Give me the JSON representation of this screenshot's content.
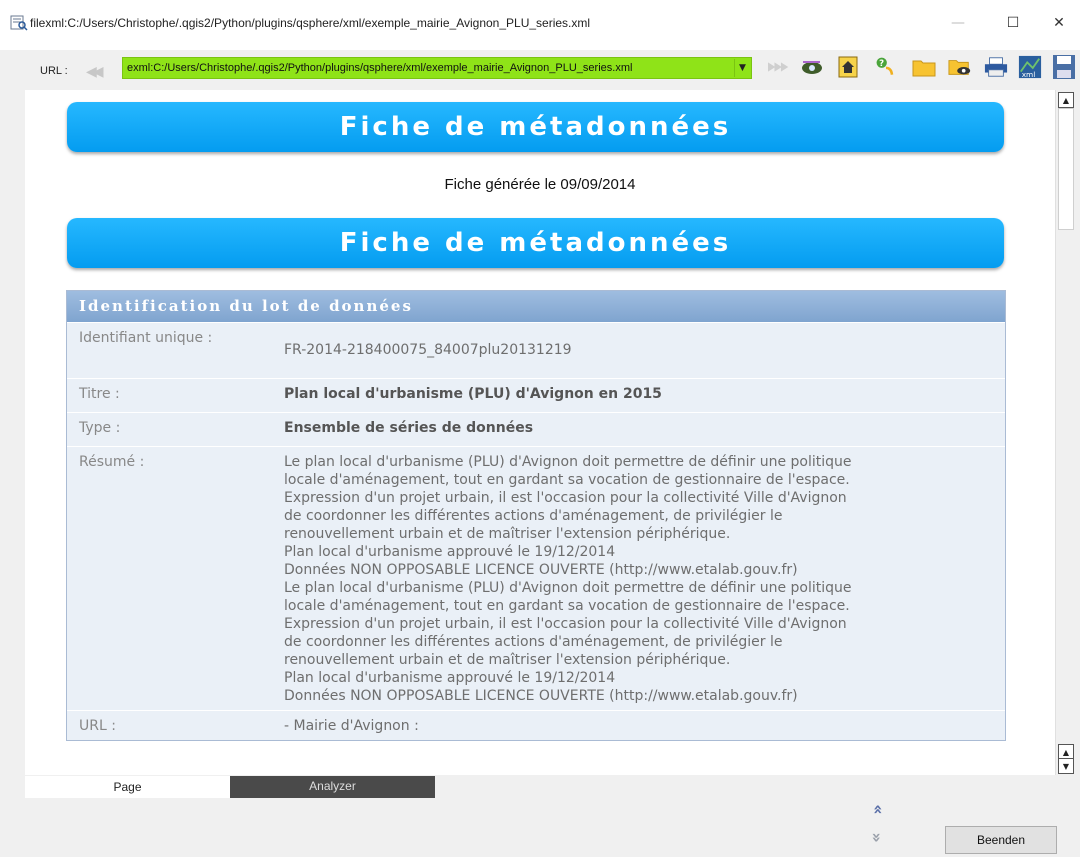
{
  "window": {
    "title": "filexml:C:/Users/Christophe/.qgis2/Python/plugins/qsphere/xml/exemple_mairie_Avignon_PLU_series.xml",
    "minimize": "—",
    "maximize": "☐",
    "close": "✕"
  },
  "urlbar": {
    "label": "URL :",
    "value": "exml:C:/Users/Christophe/.qgis2/Python/plugins/qsphere/xml/exemple_mairie_Avignon_PLU_series.xml",
    "accent_color": "#8fe318"
  },
  "toolbar_icons": [
    "forward-icon",
    "eye-icon",
    "home-icon",
    "help-icon",
    "folder-icon",
    "folder-view-icon",
    "print-icon",
    "xml-icon",
    "save-icon"
  ],
  "content": {
    "banner_title": "Fiche de métadonnées",
    "generated_text": "Fiche générée le 09/09/2014",
    "banner_title_2": "Fiche de métadonnées",
    "section_title": "Identification du lot de données",
    "rows": {
      "identifier": {
        "key": "Identifiant unique :",
        "value": "FR-2014-218400075_84007plu20131219"
      },
      "title": {
        "key": "Titre :",
        "value": "Plan local d'urbanisme (PLU) d'Avignon en 2015"
      },
      "type": {
        "key": "Type :",
        "value": "Ensemble de séries de données"
      },
      "summary": {
        "key": "Résumé :",
        "lines": [
          "Le plan local d'urbanisme (PLU) d'Avignon doit permettre de définir une politique",
          "locale d'aménagement, tout en gardant sa vocation de gestionnaire de l'espace.",
          "Expression d'un projet urbain, il est l'occasion pour la collectivité Ville d'Avignon",
          "de coordonner les différentes actions d'aménagement, de privilégier le",
          "renouvellement urbain et de maîtriser l'extension périphérique.",
          "Plan local d'urbanisme approuvé le 19/12/2014",
          "Données NON OPPOSABLE LICENCE OUVERTE (http://www.etalab.gouv.fr)",
          "Le plan local d'urbanisme (PLU) d'Avignon doit permettre de définir une politique",
          "locale d'aménagement, tout en gardant sa vocation de gestionnaire de l'espace.",
          "Expression d'un projet urbain, il est l'occasion pour la collectivité Ville d'Avignon",
          "de coordonner les différentes actions d'aménagement, de privilégier le",
          "renouvellement urbain et de maîtriser l'extension périphérique.",
          "Plan local d'urbanisme approuvé le 19/12/2014",
          "Données NON OPPOSABLE LICENCE OUVERTE (http://www.etalab.gouv.fr)"
        ]
      },
      "url": {
        "key": "URL :",
        "value": "- Mairie d'Avignon :"
      }
    }
  },
  "bottom": {
    "tab_page": "Page",
    "tab_analyzer": "Analyzer",
    "nav_up": "»",
    "nav_down": "»",
    "close_button": "Beenden"
  }
}
